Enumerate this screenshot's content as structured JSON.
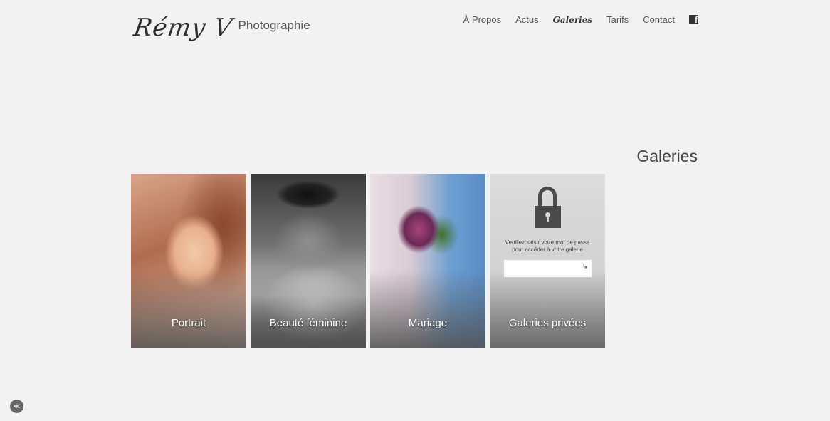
{
  "logo": {
    "script": "Rémy V",
    "sub": "Photographie"
  },
  "nav": {
    "items": [
      "À Propos",
      "Actus",
      "Galeries",
      "Tarifs",
      "Contact"
    ],
    "facebook_glyph": "f"
  },
  "page_title": "Galeries",
  "tiles": [
    {
      "caption": "Portrait"
    },
    {
      "caption": "Beauté féminine"
    },
    {
      "caption": "Mariage"
    },
    {
      "caption": "Galeries privées"
    }
  ],
  "private": {
    "prompt_line1": "Veuillez saisir votre mot de passe",
    "prompt_line2": "pour accéder à votre galerie",
    "password_value": "",
    "submit_glyph": "↳"
  },
  "corner_button_glyph": "≪"
}
